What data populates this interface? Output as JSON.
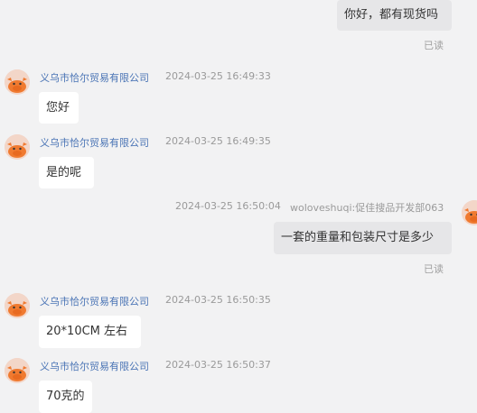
{
  "messages": [
    {
      "id": "m0",
      "direction": "out",
      "text": "你好，都有现货吗",
      "status": "已读"
    },
    {
      "id": "m1",
      "direction": "in",
      "sender": "义乌市恰尔贸易有限公司",
      "time": "2024-03-25 16:49:33",
      "text": "您好"
    },
    {
      "id": "m2",
      "direction": "in",
      "sender": "义乌市恰尔贸易有限公司",
      "time": "2024-03-25 16:49:35",
      "text": "是的呢"
    },
    {
      "id": "m3",
      "direction": "out",
      "sender": "woloveshuqi:促佳搜品开发部063",
      "time": "2024-03-25 16:50:04",
      "text": "一套的重量和包装尺寸是多少",
      "status": "已读"
    },
    {
      "id": "m4",
      "direction": "in",
      "sender": "义乌市恰尔贸易有限公司",
      "time": "2024-03-25 16:50:35",
      "text": "20*10CM 左右"
    },
    {
      "id": "m5",
      "direction": "in",
      "sender": "义乌市恰尔贸易有限公司",
      "time": "2024-03-25 16:50:37",
      "text": "70克的"
    }
  ],
  "icons": {
    "incoming_avatar": "cow-avatar-icon",
    "outgoing_avatar": "cow-avatar-icon"
  },
  "colors": {
    "background": "#f2f2f3",
    "incoming_bubble": "#ffffff",
    "outgoing_bubble": "#e6e6e8",
    "sender_name": "#4a74b5",
    "timestamp": "#9a9a9a"
  }
}
